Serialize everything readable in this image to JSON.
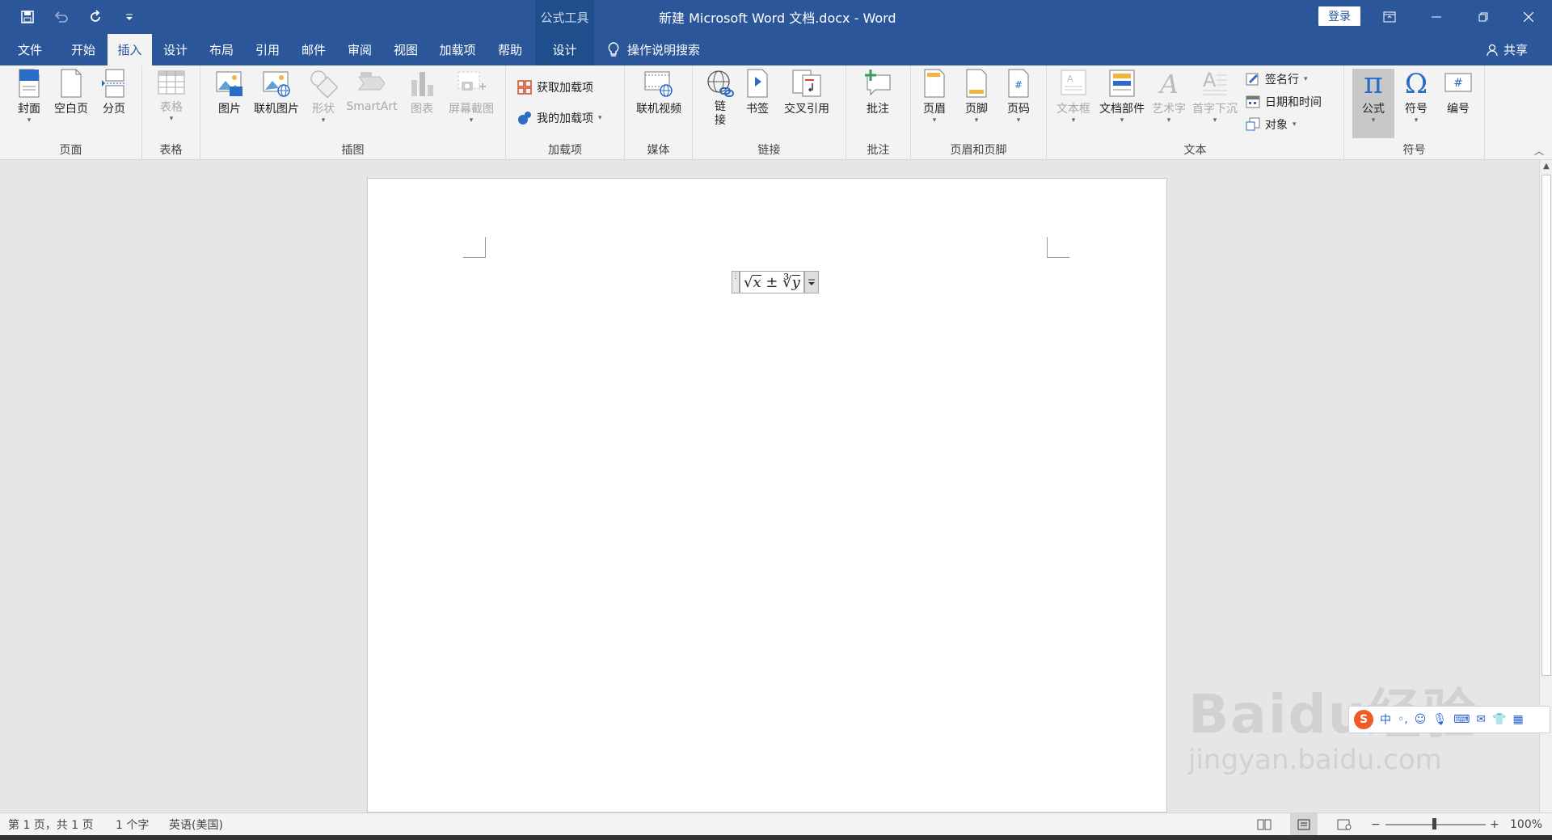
{
  "titlebar": {
    "context_tools": "公式工具",
    "doc_title": "新建 Microsoft Word 文档.docx  -  Word",
    "login": "登录"
  },
  "tabs": [
    {
      "label": "文件"
    },
    {
      "label": "开始"
    },
    {
      "label": "插入"
    },
    {
      "label": "设计"
    },
    {
      "label": "布局"
    },
    {
      "label": "引用"
    },
    {
      "label": "邮件"
    },
    {
      "label": "审阅"
    },
    {
      "label": "视图"
    },
    {
      "label": "加载项"
    },
    {
      "label": "帮助"
    },
    {
      "label": "设计"
    }
  ],
  "tellme": "操作说明搜索",
  "share": "共享",
  "ribbon": {
    "pages": {
      "label": "页面",
      "cover": "封面",
      "blank": "空白页",
      "break": "分页"
    },
    "tables": {
      "label": "表格",
      "table": "表格"
    },
    "illustrations": {
      "label": "插图",
      "picture": "图片",
      "online_picture": "联机图片",
      "shapes": "形状",
      "smartart": "SmartArt",
      "chart": "图表",
      "screenshot": "屏幕截图"
    },
    "addins": {
      "label": "加载项",
      "get": "获取加载项",
      "my": "我的加载项"
    },
    "media": {
      "label": "媒体",
      "online_video": "联机视频"
    },
    "links": {
      "label": "链接",
      "link": "链\n接",
      "bookmark": "书签",
      "crossref": "交叉引用"
    },
    "comments": {
      "label": "批注",
      "comment": "批注"
    },
    "headerfooter": {
      "label": "页眉和页脚",
      "header": "页眉",
      "footer": "页脚",
      "pagenum": "页码"
    },
    "text": {
      "label": "文本",
      "textbox": "文本框",
      "quickparts": "文档部件",
      "wordart": "艺术字",
      "dropcap": "首字下沉",
      "sigline": "签名行",
      "datetime": "日期和时间",
      "object": "对象"
    },
    "symbols": {
      "label": "符号",
      "equation": "公式",
      "symbol": "符号",
      "number": "编号"
    }
  },
  "equation": {
    "sqrt1": "√",
    "x": "x",
    "pm": " ± ",
    "cuberoot": "∛",
    "y": "y"
  },
  "ime": {
    "mode": "中"
  },
  "watermark": {
    "brand": "Baidu经验",
    "url": "jingyan.baidu.com"
  },
  "status": {
    "page": "第 1 页，共 1 页",
    "words": "1 个字",
    "language": "英语(美国)",
    "zoom": "100%"
  },
  "colors": {
    "word_blue": "#2b579a",
    "ribbon_bg": "#f3f3f3"
  }
}
